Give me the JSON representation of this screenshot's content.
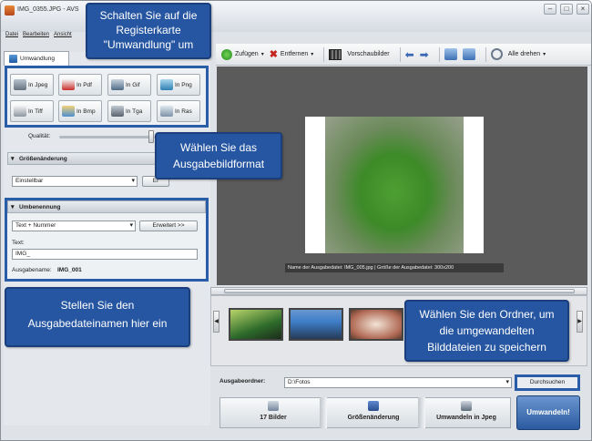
{
  "window": {
    "title": "IMG_0355.JPG - AVS",
    "menu": [
      "Datei",
      "Bearbeiten",
      "Ansicht"
    ]
  },
  "toolbar": {
    "add": "Zufügen",
    "remove": "Entfernen",
    "thumbnails": "Vorschaubilder",
    "rotate_all": "Alle drehen"
  },
  "sidebar": {
    "tab_label": "Umwandlung",
    "formats": [
      "In Jpeg",
      "In Pdf",
      "In Gif",
      "In Png",
      "In Tiff",
      "In Bmp",
      "In Tga",
      "In Ras"
    ],
    "quality_label": "Qualität:",
    "resize": {
      "title": "Größenänderung",
      "select_value": "Einstellbar",
      "button": "Er"
    },
    "rename": {
      "title": "Umbenennung",
      "select_value": "Text + Nummer",
      "advanced_button": "Erweitert >>",
      "text_label": "Text:",
      "text_value": "IMG_",
      "output_name_label": "Ausgabename:",
      "output_name_value": "IMG_001"
    }
  },
  "preview": {
    "caption": "Name der Ausgabedatei: IMG_005.jpg | Größe der Ausgabedatei: 300x200"
  },
  "output": {
    "folder_label": "Ausgabeordner:",
    "folder_value": "D:\\Fotos",
    "browse_button": "Durchsuchen"
  },
  "steps": {
    "images": "17 Bilder",
    "resize": "Größenänderung",
    "convert_to": "Umwandeln in Jpeg",
    "convert_button": "Umwandeln!"
  },
  "callouts": {
    "tab": "Schalten Sie auf die Registerkarte \"Umwandlung\" um",
    "format": "Wählen Sie das Ausgabebildformat",
    "filename": "Stellen Sie den Ausgabedateinamen hier ein",
    "folder": "Wählen Sie den Ordner, um die umgewandelten Bilddateien zu speichern"
  }
}
